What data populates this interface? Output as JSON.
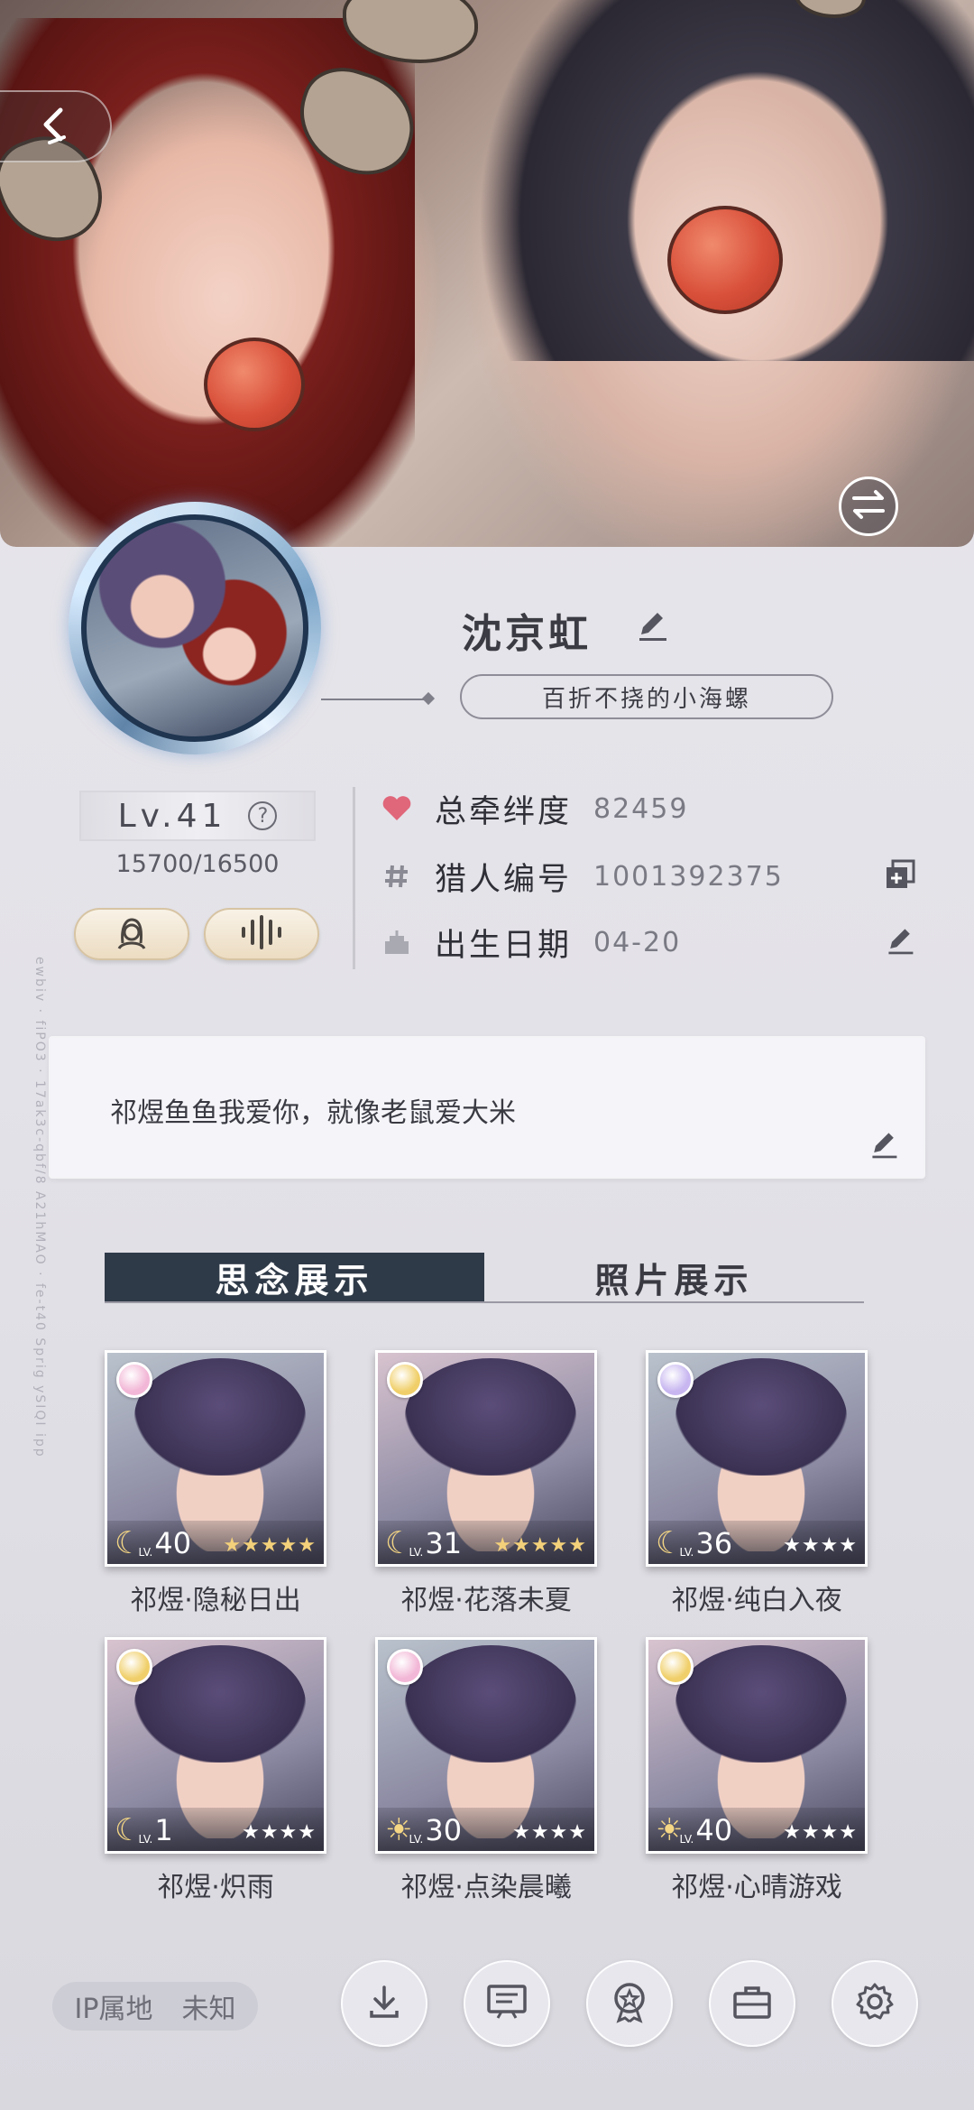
{
  "profile": {
    "name": "沈京虹",
    "motto": "百折不挠的小海螺",
    "level_label": "Lv.41",
    "exp_text": "15700/16500",
    "help_glyph": "?"
  },
  "info": {
    "bond_label": "总牵绊度",
    "bond_value": "82459",
    "hunter_label": "猎人编号",
    "hunter_value": "1001392375",
    "birthday_label": "出生日期",
    "birthday_value": "04-20"
  },
  "signature": {
    "text": "祁煜鱼鱼我爱你，就像老鼠爱大米"
  },
  "tabs": [
    {
      "label": "思念展示",
      "active": true
    },
    {
      "label": "照片展示",
      "active": false
    }
  ],
  "cards": [
    {
      "caption": "祁煜·隐秘日出",
      "level": "40",
      "lv": "LV.",
      "moon": "☾",
      "stars": "★★★★★",
      "star_color": "#f3d07a",
      "badge_color": "#f2b7d6"
    },
    {
      "caption": "祁煜·花落未夏",
      "level": "31",
      "lv": "LV.",
      "moon": "☾",
      "stars": "★★★★★",
      "star_color": "#f3d07a",
      "badge_color": "#f0cf6a"
    },
    {
      "caption": "祁煜·纯白入夜",
      "level": "36",
      "lv": "LV.",
      "moon": "☾",
      "stars": "★★★★",
      "star_color": "#ffffff",
      "badge_color": "#c7b6f0"
    },
    {
      "caption": "祁煜·炽雨",
      "level": "1",
      "lv": "LV.",
      "moon": "☾",
      "stars": "★★★★",
      "star_color": "#ffffff",
      "badge_color": "#f0cf6a"
    },
    {
      "caption": "祁煜·点染晨曦",
      "level": "30",
      "lv": "LV.",
      "moon": "☀",
      "stars": "★★★★",
      "star_color": "#ffffff",
      "badge_color": "#f2b7d6"
    },
    {
      "caption": "祁煜·心晴游戏",
      "level": "40",
      "lv": "LV.",
      "moon": "☀",
      "stars": "★★★★",
      "star_color": "#ffffff",
      "badge_color": "#f0cf6a"
    }
  ],
  "footer": {
    "ip_label": "IP属地",
    "ip_value": "未知"
  },
  "side_text": "ewbiv  ·  fiPO3  ·  17ak3c-qbf/8 A21hMAO  ·  fe-t40 Sprig ySIQI ipp",
  "icons": {
    "back": "back-icon",
    "swap": "swap-icon",
    "edit": "pencil-icon",
    "heart": "heart-icon",
    "hash": "hash-icon",
    "cake": "cake-icon",
    "copy": "copy-icon",
    "avatar_btn": "portrait-icon",
    "voice_btn": "voice-wave-icon",
    "download": "download-icon",
    "board": "board-icon",
    "medal": "medal-icon",
    "briefcase": "briefcase-icon",
    "settings": "gear-icon"
  },
  "colors": {
    "accent": "#2f3a48",
    "heart": "#e0667a",
    "pill_gold": "#ecdcc2"
  }
}
